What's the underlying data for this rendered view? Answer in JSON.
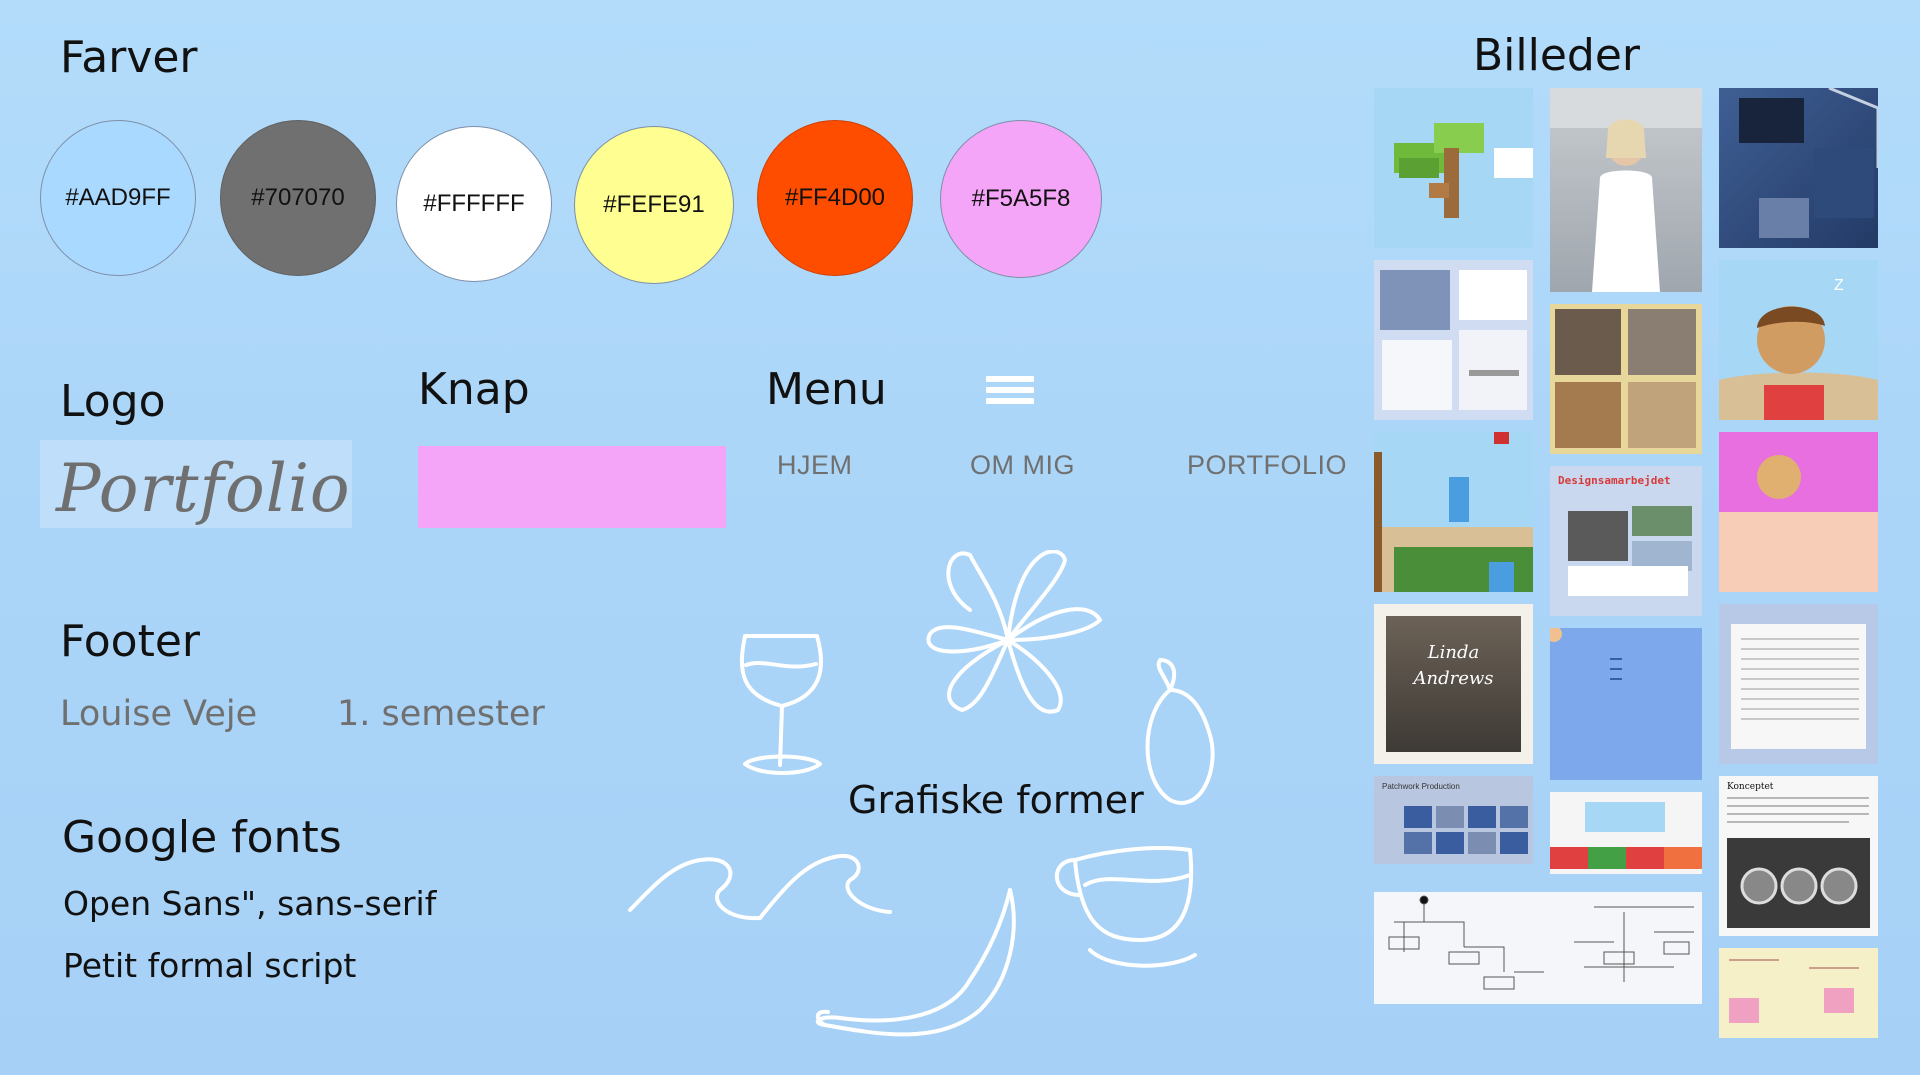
{
  "sections": {
    "colors_title": "Farver",
    "logo_title": "Logo",
    "button_title": "Knap",
    "menu_title": "Menu",
    "footer_title": "Footer",
    "fonts_title": "Google fonts",
    "shapes_title": "Grafiske former",
    "images_title": "Billeder"
  },
  "colors": [
    {
      "label": "#AAD9FF",
      "hex": "#AAD9FF"
    },
    {
      "label": "#707070",
      "hex": "#707070"
    },
    {
      "label": "#FFFFFF",
      "hex": "#FFFFFF"
    },
    {
      "label": "#FEFE91",
      "hex": "#FEFE91"
    },
    {
      "label": "#FF4D00",
      "hex": "#FF4D00"
    },
    {
      "label": "#F5A5F8",
      "hex": "#F5A5F8"
    }
  ],
  "logo": {
    "text": "Portfolio"
  },
  "button": {
    "color": "#F5A5F8"
  },
  "menu": {
    "icon": "hamburger-menu-icon",
    "items": [
      "HJEM",
      "OM MIG",
      "PORTFOLIO"
    ]
  },
  "footer": {
    "name": "Louise Veje",
    "semester": "1. semester"
  },
  "fonts": {
    "primary": "Open Sans\", sans-serif",
    "secondary": "Petit formal script"
  },
  "shapes": [
    "wine-glass-icon",
    "flower-icon",
    "lemon-icon",
    "wave-icon",
    "banana-icon",
    "cup-icon"
  ],
  "images": {
    "linda_line1": "Linda",
    "linda_line2": "Andrews",
    "design_title": "Designsamarbejdet",
    "patchwork_title": "Patchwork Production",
    "koncept_title": "Konceptet"
  }
}
